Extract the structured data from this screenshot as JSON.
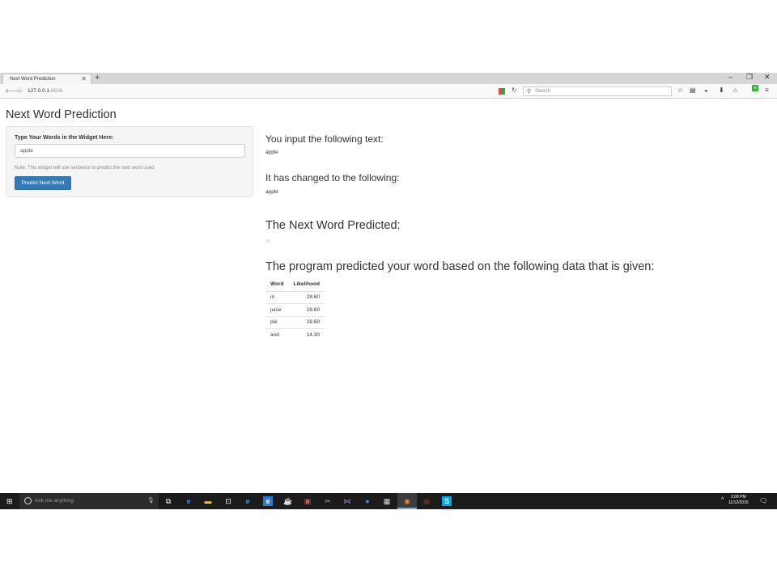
{
  "browser": {
    "tab_title": "Next Word Prediction",
    "tab_close": "✕",
    "new_tab": "+",
    "url_host": "127.0.0.1",
    "url_port": ":6636",
    "search_placeholder": "Search",
    "window_controls": [
      "–",
      "❐",
      "✕"
    ]
  },
  "page": {
    "title": "Next Word Prediction",
    "input_label": "Type Your Words in the Widget Here:",
    "input_value": "apple",
    "help_note": "Note: This widget will use sentence to predict the next word used",
    "predict_button": "Predict Next Word"
  },
  "main": {
    "input_heading": "You input the following text:",
    "input_text": "apple",
    "changed_heading": "It has changed to the following:",
    "changed_text": "apple",
    "prediction_heading": "The Next Word Predicted:",
    "prediction": "in",
    "data_heading": "The program predicted your word based on the following data that is given:",
    "table": {
      "headers": [
        "Word",
        "Likelihood"
      ],
      "rows": [
        {
          "word": "in",
          "likelihood": "28.60"
        },
        {
          "word": "juice",
          "likelihood": "28.60"
        },
        {
          "word": "pie",
          "likelihood": "28.60"
        },
        {
          "word": "and",
          "likelihood": "14.30"
        }
      ]
    }
  },
  "taskbar": {
    "search_placeholder": "Ask me anything",
    "time": "2:09 PM",
    "date": "11/12/2016"
  }
}
